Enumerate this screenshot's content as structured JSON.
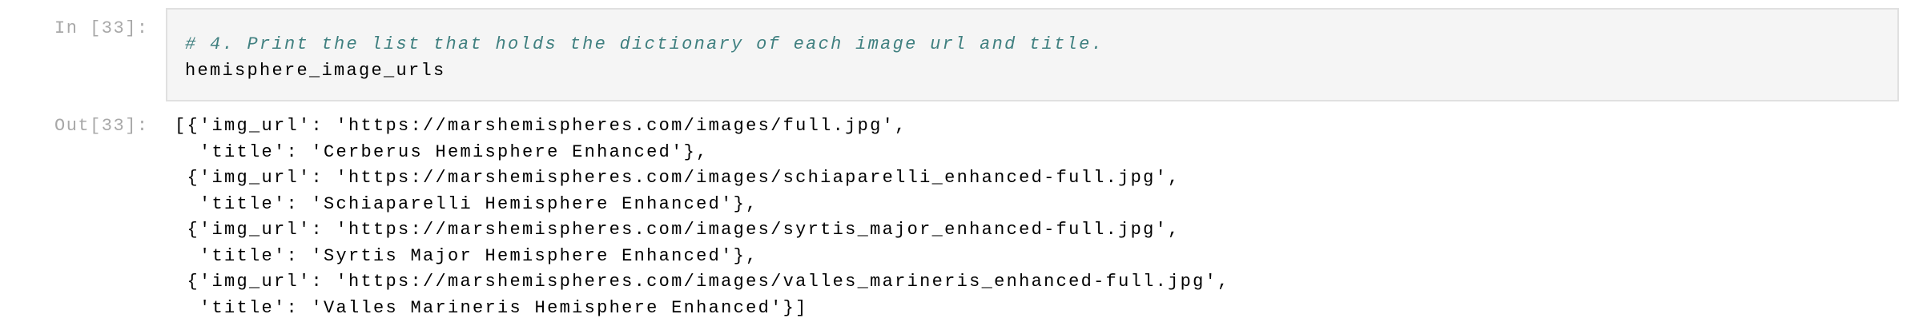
{
  "input_cell": {
    "prompt": "In [33]:",
    "lines": [
      "# 4. Print the list that holds the dictionary of each image url and title.",
      "hemisphere_image_urls"
    ]
  },
  "output_cell": {
    "prompt": "Out[33]:",
    "lines": [
      "[{'img_url': 'https://marshemispheres.com/images/full.jpg',",
      "  'title': 'Cerberus Hemisphere Enhanced'},",
      " {'img_url': 'https://marshemispheres.com/images/schiaparelli_enhanced-full.jpg',",
      "  'title': 'Schiaparelli Hemisphere Enhanced'},",
      " {'img_url': 'https://marshemispheres.com/images/syrtis_major_enhanced-full.jpg',",
      "  'title': 'Syrtis Major Hemisphere Enhanced'},",
      " {'img_url': 'https://marshemispheres.com/images/valles_marineris_enhanced-full.jpg',",
      "  'title': 'Valles Marineris Hemisphere Enhanced'}]"
    ]
  },
  "colors": {
    "comment": "#408080",
    "prompt": "#a8a8a8",
    "input_bg": "#f5f5f5"
  }
}
